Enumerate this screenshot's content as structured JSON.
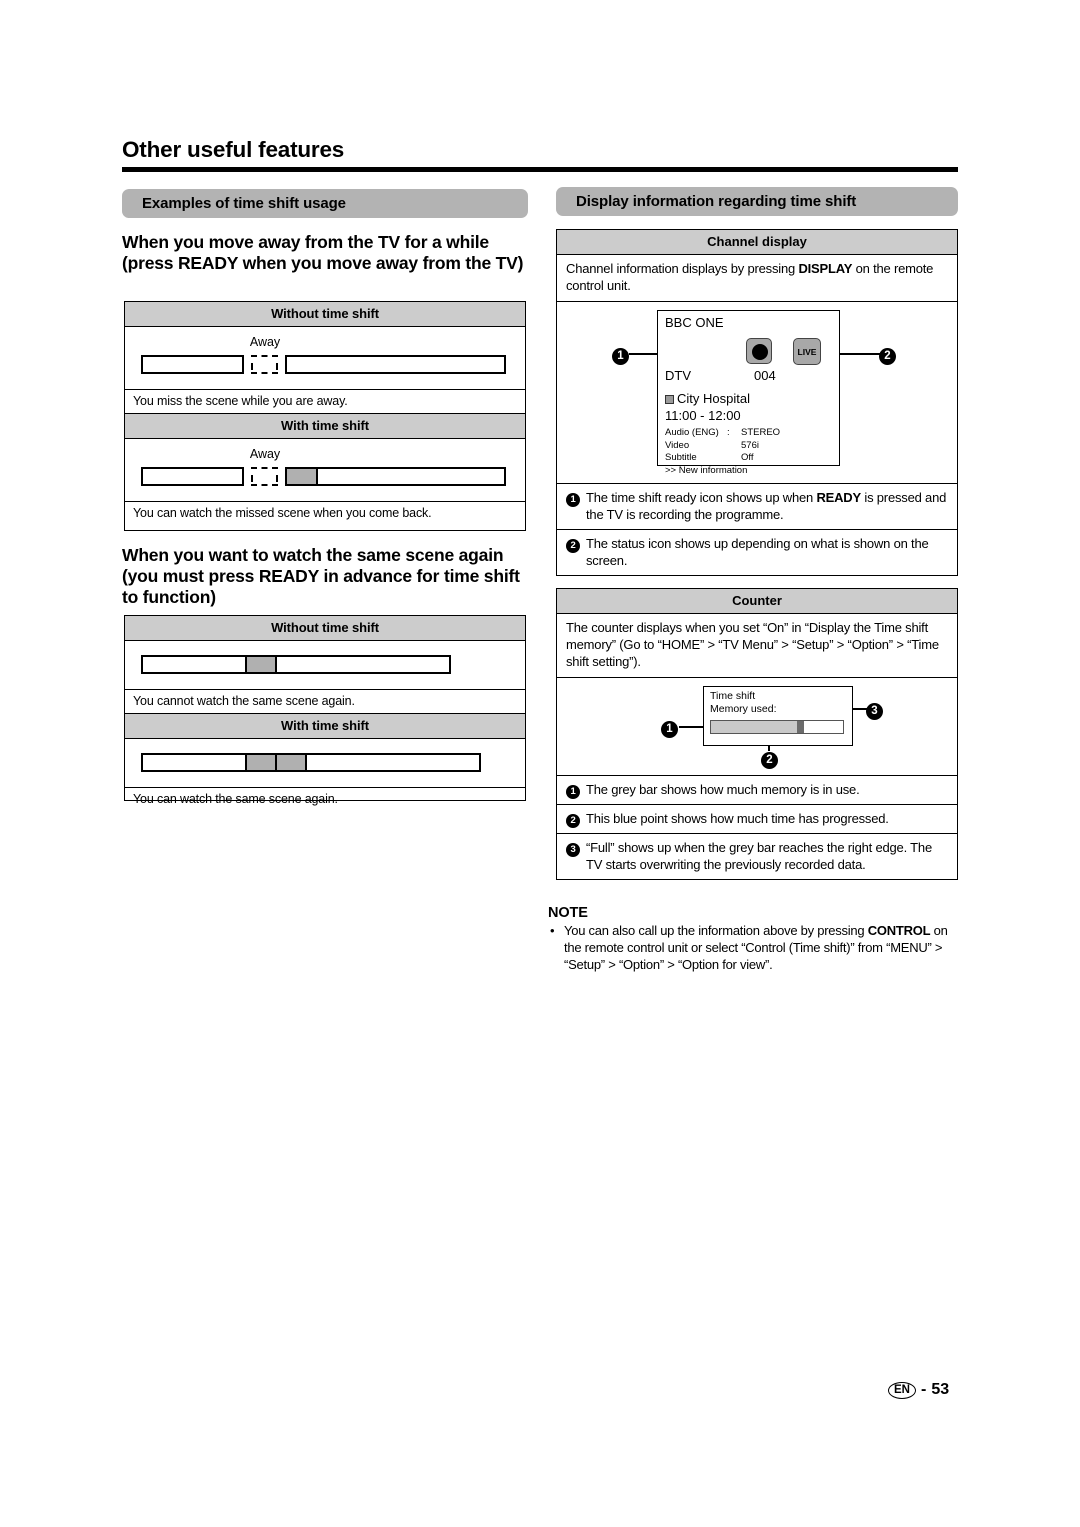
{
  "page": {
    "title": "Other useful features",
    "footer": {
      "lang_badge": "EN",
      "separator": "-",
      "page_number": "53"
    }
  },
  "left_column": {
    "banner": "Examples of time shift usage",
    "section_1": {
      "heading": "When you move away from the TV for a while (press READY when you move away from the TV)",
      "rows": [
        {
          "header": "Without time shift",
          "away_label": "Away",
          "caption": "You miss the scene while you are away."
        },
        {
          "header": "With time shift",
          "away_label": "Away",
          "caption": "You can watch the missed scene when you come back."
        }
      ]
    },
    "section_2": {
      "heading": "When you want to watch the same scene again (you must press READY in advance for time shift to function)",
      "rows": [
        {
          "header": "Without time shift",
          "caption": "You cannot watch the same scene again."
        },
        {
          "header": "With time shift",
          "caption": "You can watch the same scene again."
        }
      ]
    }
  },
  "right_column": {
    "banner": "Display information regarding time shift",
    "channel_display": {
      "header": "Channel display",
      "intro_before": "Channel information displays by pressing ",
      "intro_bold": "DISPLAY",
      "intro_after": " on the remote control unit.",
      "tv": {
        "channel_name": "BBC ONE",
        "rec_icon": "record-dot-icon",
        "live_badge": "LIVE",
        "source": "DTV",
        "channel_number": "004",
        "programme_icon": "programme-info-icon",
        "programme": "City Hospital",
        "time": "11:00 - 12:00",
        "details": [
          {
            "key": "Audio (ENG)",
            "colon": ":",
            "value": "STEREO"
          },
          {
            "key": "Video",
            "colon": "",
            "value": "576i"
          },
          {
            "key": "Subtitle",
            "colon": "",
            "value": "Off"
          }
        ],
        "new_information": ">> New information"
      },
      "callouts": [
        {
          "num": "1",
          "text_before": "The time shift ready icon shows up when ",
          "bold": "READY",
          "text_after": " is pressed and the TV is recording the programme."
        },
        {
          "num": "2",
          "text_before": "The status icon shows up depending on what is shown on the screen.",
          "bold": "",
          "text_after": ""
        }
      ]
    },
    "counter": {
      "header": "Counter",
      "intro": "The counter displays when you set “On” in “Display the Time shift memory” (Go to “HOME” > “TV Menu” > “Setup” > “Option” > “Time shift setting”).",
      "mock": {
        "line1": "Time shift",
        "line2": "Memory used:"
      },
      "callouts": [
        {
          "num": "1",
          "text": "The grey bar shows how much memory is in use."
        },
        {
          "num": "2",
          "text": "This blue point shows how much time has progressed."
        },
        {
          "num": "3",
          "text": "“Full” shows up when the grey bar reaches the right edge. The TV starts overwriting the previously recorded data."
        }
      ]
    },
    "note": {
      "title": "NOTE",
      "bullet": "•",
      "text_1": "You can also call up the information above by pressing ",
      "bold": "CONTROL",
      "text_2": " on the remote control unit or select “Control (Time shift)” from “MENU” > “Setup” > “Option” > “Option for view”."
    }
  },
  "colors": {
    "banner_grey": "#b3b3b3",
    "table_head_grey": "#cccccc",
    "bar_grey": "#b0b0b0",
    "icon_grey": "#a8a8a8"
  }
}
